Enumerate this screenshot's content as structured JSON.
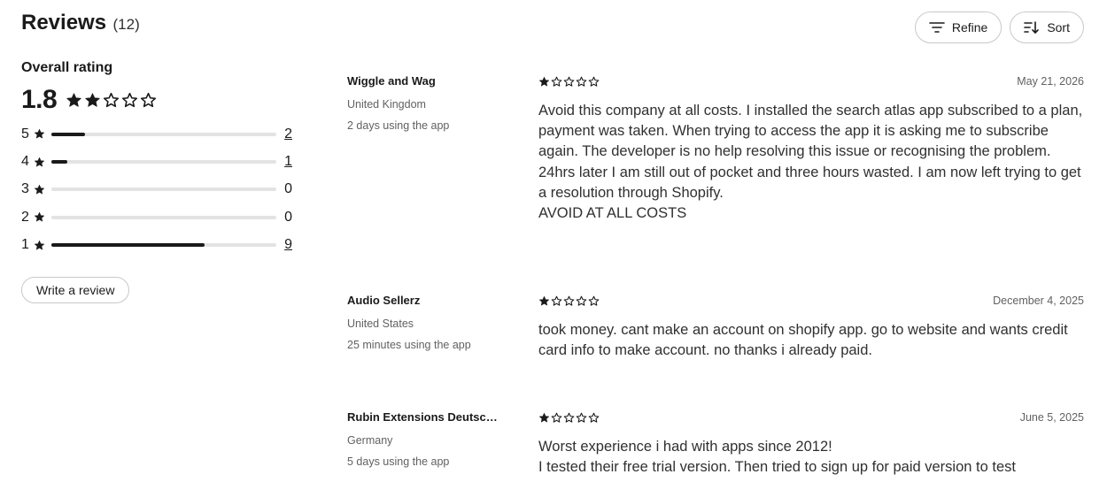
{
  "header": {
    "title": "Reviews",
    "count": "(12)"
  },
  "actions": {
    "refine_label": "Refine",
    "sort_label": "Sort"
  },
  "overall": {
    "label": "Overall rating",
    "score": "1.8",
    "stars_filled": 2,
    "distribution": [
      {
        "stars": "5",
        "count": "2",
        "fraction": 0.15,
        "link": true
      },
      {
        "stars": "4",
        "count": "1",
        "fraction": 0.07,
        "link": true
      },
      {
        "stars": "3",
        "count": "0",
        "fraction": 0,
        "link": false
      },
      {
        "stars": "2",
        "count": "0",
        "fraction": 0,
        "link": false
      },
      {
        "stars": "1",
        "count": "9",
        "fraction": 0.68,
        "link": true
      }
    ]
  },
  "write_review_label": "Write a review",
  "icons": {
    "refine": "filter-lines-icon",
    "sort": "sort-icon",
    "star": "star-icon"
  },
  "colors": {
    "text": "#303030",
    "muted": "#616161",
    "bar_fill": "#1a1a1a",
    "bar_track": "#e3e3e3"
  },
  "reviews": [
    {
      "name": "Wiggle and Wag",
      "country": "United Kingdom",
      "usage": "2 days using the app",
      "rating": 1,
      "date": "May 21, 2026",
      "body": [
        "Avoid this company at all costs. I installed the search atlas app subscribed to a plan, payment was taken. When trying to access the app it is asking me to subscribe again. The developer is no help resolving this issue or recognising the problem.",
        "24hrs later I am still out of pocket and three hours wasted. I am now left trying to get a resolution through Shopify.",
        "AVOID AT ALL COSTS"
      ]
    },
    {
      "name": "Audio Sellerz",
      "country": "United States",
      "usage": "25 minutes using the app",
      "rating": 1,
      "date": "December 4, 2025",
      "body": [
        "took money. cant make an account on shopify app. go to website and wants credit card info to make account. no thanks i already paid."
      ]
    },
    {
      "name": "Rubin Extensions Deutschland",
      "country": "Germany",
      "usage": "5 days using the app",
      "rating": 1,
      "date": "June 5, 2025",
      "body": [
        "Worst experience i had with apps since 2012!",
        "I tested their free trial version. Then tried to sign up for paid version to test"
      ]
    }
  ]
}
